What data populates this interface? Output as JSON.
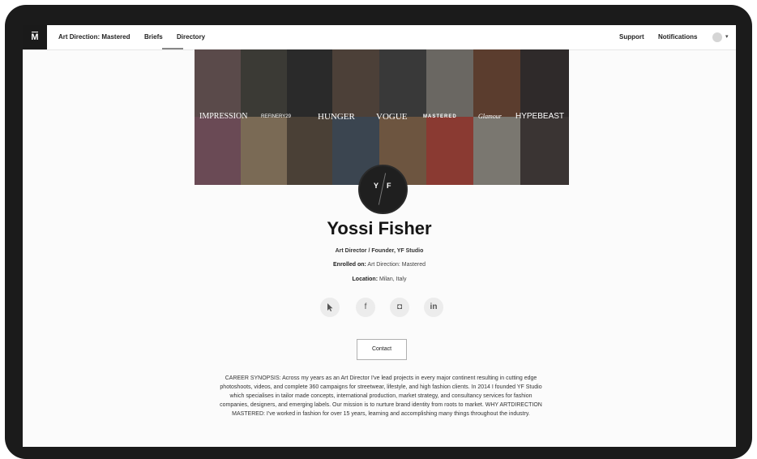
{
  "nav": {
    "logo": "M",
    "course": "Art Direction: Mastered",
    "briefs": "Briefs",
    "directory": "Directory",
    "support": "Support",
    "notifications": "Notifications",
    "caret": "▾"
  },
  "banner": {
    "brands": [
      "IMPRESSION",
      "REFINERY29",
      "HUNGER",
      "VOGUE",
      "MASTERED",
      "Glamour",
      "HYPEBEAST"
    ]
  },
  "profile": {
    "initials_left": "Y",
    "initials_right": "F",
    "name": "Yossi Fisher",
    "role": "Art Director / Founder, YF Studio",
    "enrolled_label": "Enrolled on:",
    "enrolled_value": "Art Direction: Mastered",
    "location_label": "Location:",
    "location_value": "Milan, Italy"
  },
  "social": {
    "website_icon": "cursor-icon",
    "facebook": "f",
    "instagram": "◘",
    "linkedin": "in"
  },
  "contact_label": "Contact",
  "synopsis": "CAREER SYNOPSIS: Across my years as an Art Director I've lead projects in every major continent resulting in cutting edge photoshoots, videos, and complete 360 campaigns for streetwear, lifestyle, and high fashion clients. In 2014 I founded YF Studio which specialises in tailor made concepts, international production, market strategy, and consultancy services for fashion companies, designers, and emerging labels. Our mission is to nurture brand identity from roots to market. WHY ARTDIRECTION MASTERED: I've worked in fashion for over 15 years, learning and accomplishing many things throughout the industry."
}
